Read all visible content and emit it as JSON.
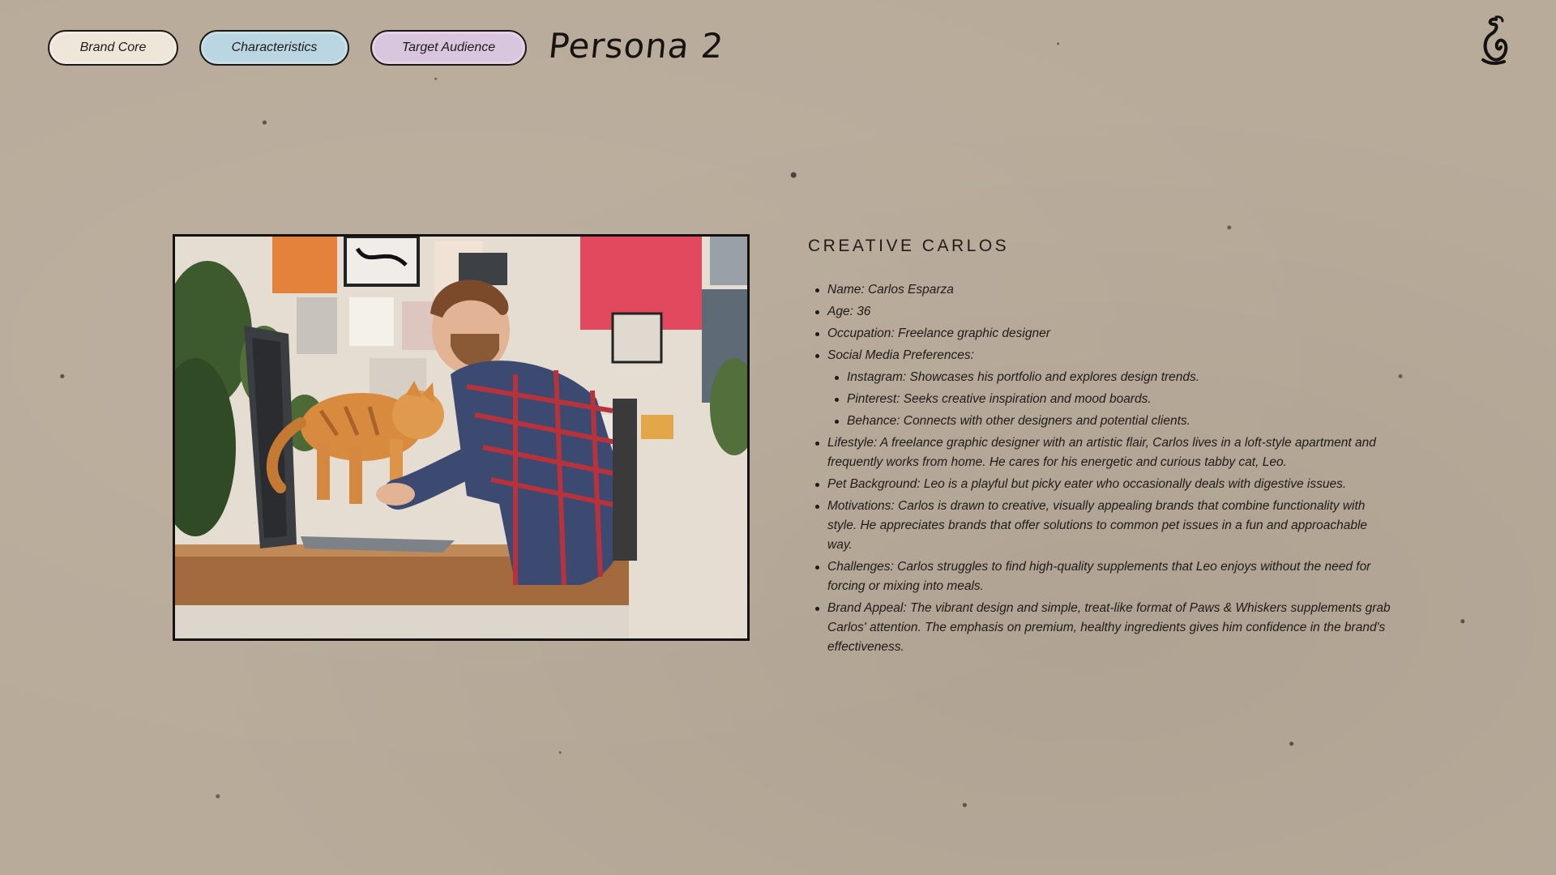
{
  "nav": {
    "brand_core": {
      "label": "Brand Core",
      "color": "#efe6da"
    },
    "characteristics": {
      "label": "Characteristics",
      "color": "#b9d6e2"
    },
    "target_audience": {
      "label": "Target Audience",
      "color": "#d8c6de"
    }
  },
  "page_heading": "Persona 2",
  "logo_icon": "hand-drawn-flame-logo-icon",
  "photo_icon": "photo-man-with-cat-at-laptop",
  "persona": {
    "title": "CREATIVE CARLOS",
    "name": "Name: Carlos Esparza",
    "age": "Age: 36",
    "occupation": "Occupation: Freelance graphic designer",
    "social_media": "Social Media Preferences:",
    "social_items": [
      "Instagram: Showcases his portfolio and explores design trends.",
      "Pinterest: Seeks creative inspiration and mood boards.",
      "Behance: Connects with other designers and potential clients."
    ],
    "lifestyle": "Lifestyle: A freelance graphic designer with an artistic flair, Carlos lives in a loft-style apartment and frequently works from home. He cares for his energetic and curious tabby cat, Leo.",
    "pet_background": "Pet Background: Leo is a playful but picky eater who occasionally deals with digestive issues.",
    "motivations": "Motivations: Carlos is drawn to creative, visually appealing brands that combine functionality with style. He appreciates brands that offer solutions to common pet issues in a fun and approachable way.",
    "challenges": "Challenges: Carlos struggles to find high-quality supplements that Leo enjoys without the need for forcing or mixing into meals.",
    "brand_appeal": "Brand Appeal: The vibrant design and simple, treat-like format of Paws & Whiskers supplements grab Carlos' attention. The emphasis on premium, healthy ingredients gives him confidence in the brand's effectiveness."
  },
  "colors": {
    "background": "#b9ab9a",
    "ink": "#1b1816"
  }
}
